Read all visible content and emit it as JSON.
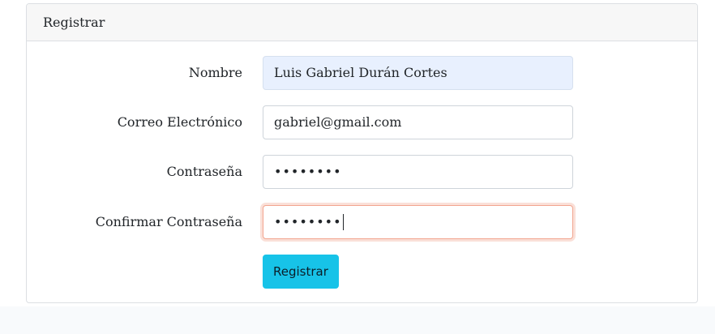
{
  "card": {
    "title": "Registrar"
  },
  "form": {
    "fields": [
      {
        "label": "Nombre",
        "value": "Luis Gabriel Durán Cortes"
      },
      {
        "label": "Correo Electrónico",
        "value": "gabriel@gmail.com"
      },
      {
        "label": "Contraseña",
        "value": "••••••••"
      },
      {
        "label": "Confirmar Contraseña",
        "value": "••••••••"
      }
    ],
    "submit_label": "Registrar"
  },
  "colors": {
    "button": "#17c3e8",
    "autofill_bg": "#e8f0fe",
    "focus_border": "#f2a58f"
  }
}
